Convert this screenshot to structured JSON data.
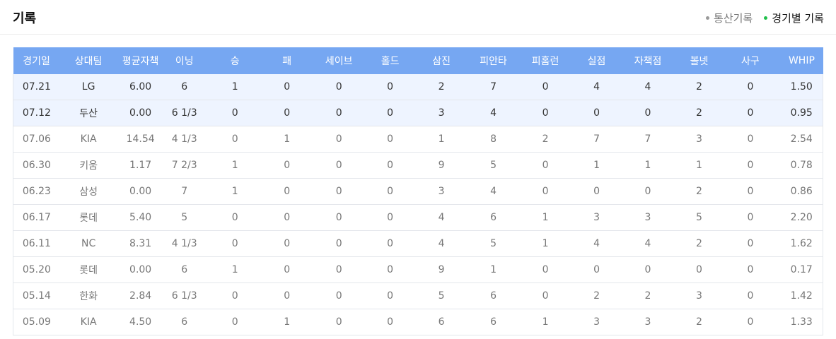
{
  "header": {
    "title": "기록",
    "tabs": [
      {
        "label": "통산기록",
        "active": false
      },
      {
        "label": "경기별 기록",
        "active": true
      }
    ]
  },
  "colors": {
    "header_bg": "#76a7f2",
    "highlight_row": "#eef4ff",
    "active_dot": "#1fbf4a"
  },
  "table": {
    "columns": [
      "경기일",
      "상대팀",
      "평균자책",
      "이닝",
      "승",
      "패",
      "세이브",
      "홀드",
      "삼진",
      "피안타",
      "피홈런",
      "실점",
      "자책점",
      "볼넷",
      "사구",
      "WHIP"
    ],
    "rows": [
      {
        "highlight": true,
        "cells": [
          "07.21",
          "LG",
          "6.00",
          "6",
          "1",
          "0",
          "0",
          "0",
          "2",
          "7",
          "0",
          "4",
          "4",
          "2",
          "0",
          "1.50"
        ]
      },
      {
        "highlight": true,
        "cells": [
          "07.12",
          "두산",
          "0.00",
          "6 1/3",
          "0",
          "0",
          "0",
          "0",
          "3",
          "4",
          "0",
          "0",
          "0",
          "2",
          "0",
          "0.95"
        ]
      },
      {
        "highlight": false,
        "cells": [
          "07.06",
          "KIA",
          "14.54",
          "4 1/3",
          "0",
          "1",
          "0",
          "0",
          "1",
          "8",
          "2",
          "7",
          "7",
          "3",
          "0",
          "2.54"
        ]
      },
      {
        "highlight": false,
        "cells": [
          "06.30",
          "키움",
          "1.17",
          "7 2/3",
          "1",
          "0",
          "0",
          "0",
          "9",
          "5",
          "0",
          "1",
          "1",
          "1",
          "0",
          "0.78"
        ]
      },
      {
        "highlight": false,
        "cells": [
          "06.23",
          "삼성",
          "0.00",
          "7",
          "1",
          "0",
          "0",
          "0",
          "3",
          "4",
          "0",
          "0",
          "0",
          "2",
          "0",
          "0.86"
        ]
      },
      {
        "highlight": false,
        "cells": [
          "06.17",
          "롯데",
          "5.40",
          "5",
          "0",
          "0",
          "0",
          "0",
          "4",
          "6",
          "1",
          "3",
          "3",
          "5",
          "0",
          "2.20"
        ]
      },
      {
        "highlight": false,
        "cells": [
          "06.11",
          "NC",
          "8.31",
          "4 1/3",
          "0",
          "0",
          "0",
          "0",
          "4",
          "5",
          "1",
          "4",
          "4",
          "2",
          "0",
          "1.62"
        ]
      },
      {
        "highlight": false,
        "cells": [
          "05.20",
          "롯데",
          "0.00",
          "6",
          "1",
          "0",
          "0",
          "0",
          "9",
          "1",
          "0",
          "0",
          "0",
          "0",
          "0",
          "0.17"
        ]
      },
      {
        "highlight": false,
        "cells": [
          "05.14",
          "한화",
          "2.84",
          "6 1/3",
          "0",
          "0",
          "0",
          "0",
          "5",
          "6",
          "0",
          "2",
          "2",
          "3",
          "0",
          "1.42"
        ]
      },
      {
        "highlight": false,
        "cells": [
          "05.09",
          "KIA",
          "4.50",
          "6",
          "0",
          "1",
          "0",
          "0",
          "6",
          "6",
          "1",
          "3",
          "3",
          "2",
          "0",
          "1.33"
        ]
      }
    ]
  }
}
